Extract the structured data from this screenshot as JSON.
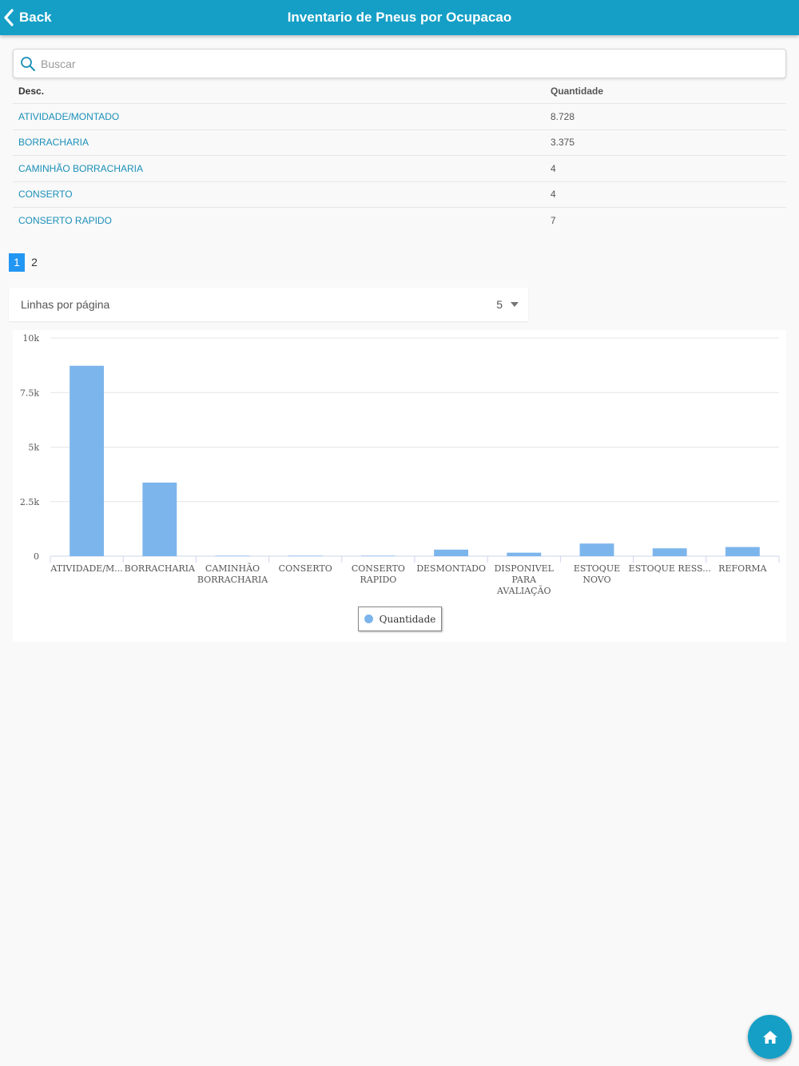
{
  "header": {
    "back_label": "Back",
    "title": "Inventario de Pneus por Ocupacao"
  },
  "search": {
    "placeholder": "Buscar",
    "value": ""
  },
  "table": {
    "columns": [
      "Desc.",
      "Quantidade"
    ],
    "rows": [
      {
        "desc": "ATIVIDADE/MONTADO",
        "qty": "8.728"
      },
      {
        "desc": "BORRACHARIA",
        "qty": "3.375"
      },
      {
        "desc": "CAMINHÃO BORRACHARIA",
        "qty": "4"
      },
      {
        "desc": "CONSERTO",
        "qty": "4"
      },
      {
        "desc": "CONSERTO RAPIDO",
        "qty": "7"
      }
    ]
  },
  "pagination": {
    "pages": [
      "1",
      "2"
    ],
    "current": "1"
  },
  "rows_per_page": {
    "label": "Linhas por página",
    "value": "5"
  },
  "colors": {
    "header": "#159fc6",
    "bar": "#7cb5ec",
    "link": "#1a8fb8",
    "page_active": "#2196f3"
  },
  "chart_data": {
    "type": "bar",
    "categories": [
      "ATIVIDADE/M...",
      "BORRACHARIA",
      "CAMINHÃO BORRACHARIA",
      "CONSERTO",
      "CONSERTO RAPIDO",
      "DESMONTADO",
      "DISPONIVEL PARA AVALIAÇÃO",
      "ESTOQUE NOVO",
      "ESTOQUE RESS...",
      "REFORMA"
    ],
    "category_lines": [
      [
        "ATIVIDADE/M..."
      ],
      [
        "BORRACHARIA"
      ],
      [
        "CAMINHÃO",
        "BORRACHARIA"
      ],
      [
        "CONSERTO"
      ],
      [
        "CONSERTO",
        "RAPIDO"
      ],
      [
        "DESMONTADO"
      ],
      [
        "DISPONIVEL",
        "PARA",
        "AVALIAÇÃO"
      ],
      [
        "ESTOQUE",
        "NOVO"
      ],
      [
        "ESTOQUE RESS..."
      ],
      [
        "REFORMA"
      ]
    ],
    "series": [
      {
        "name": "Quantidade",
        "values": [
          8728,
          3375,
          4,
          4,
          7,
          300,
          160,
          580,
          360,
          420
        ]
      }
    ],
    "yticks": [
      "0",
      "2.5k",
      "5k",
      "7.5k",
      "10k"
    ],
    "ytick_values": [
      0,
      2500,
      5000,
      7500,
      10000
    ],
    "ylim": [
      0,
      10000
    ],
    "grid": true,
    "legend_position": "bottom-center"
  }
}
